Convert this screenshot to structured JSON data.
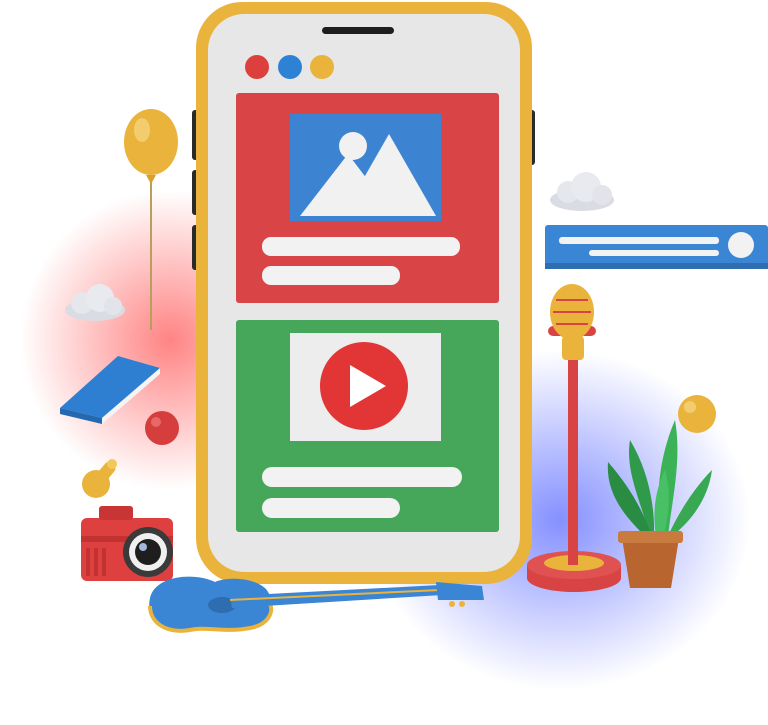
{
  "colors": {
    "phone_frame": "#E9B33C",
    "phone_screen": "#E7E7E7",
    "image_card": "#D94446",
    "video_card": "#46A75B",
    "image_tile": "#3C84D2",
    "dot_red": "#DD3F3C",
    "dot_blue": "#2D82D6",
    "dot_yellow": "#E9B33C",
    "play_button": "#E23535",
    "text_bar": "#F2F2F2",
    "blue_panel": "#3A86D5",
    "glow_red": "#FF6E6E",
    "glow_blue": "#6F7DFF"
  },
  "icons": {
    "window_dots": [
      "red-dot-icon",
      "blue-dot-icon",
      "yellow-dot-icon"
    ],
    "image_placeholder": "mountain-image-icon",
    "play": "play-icon",
    "decorations": [
      "balloon-icon",
      "cloud-icon",
      "book-icon",
      "ball-icon",
      "camera-icon",
      "microphone-icon",
      "plant-icon",
      "guitar-icon",
      "key-icon"
    ]
  }
}
